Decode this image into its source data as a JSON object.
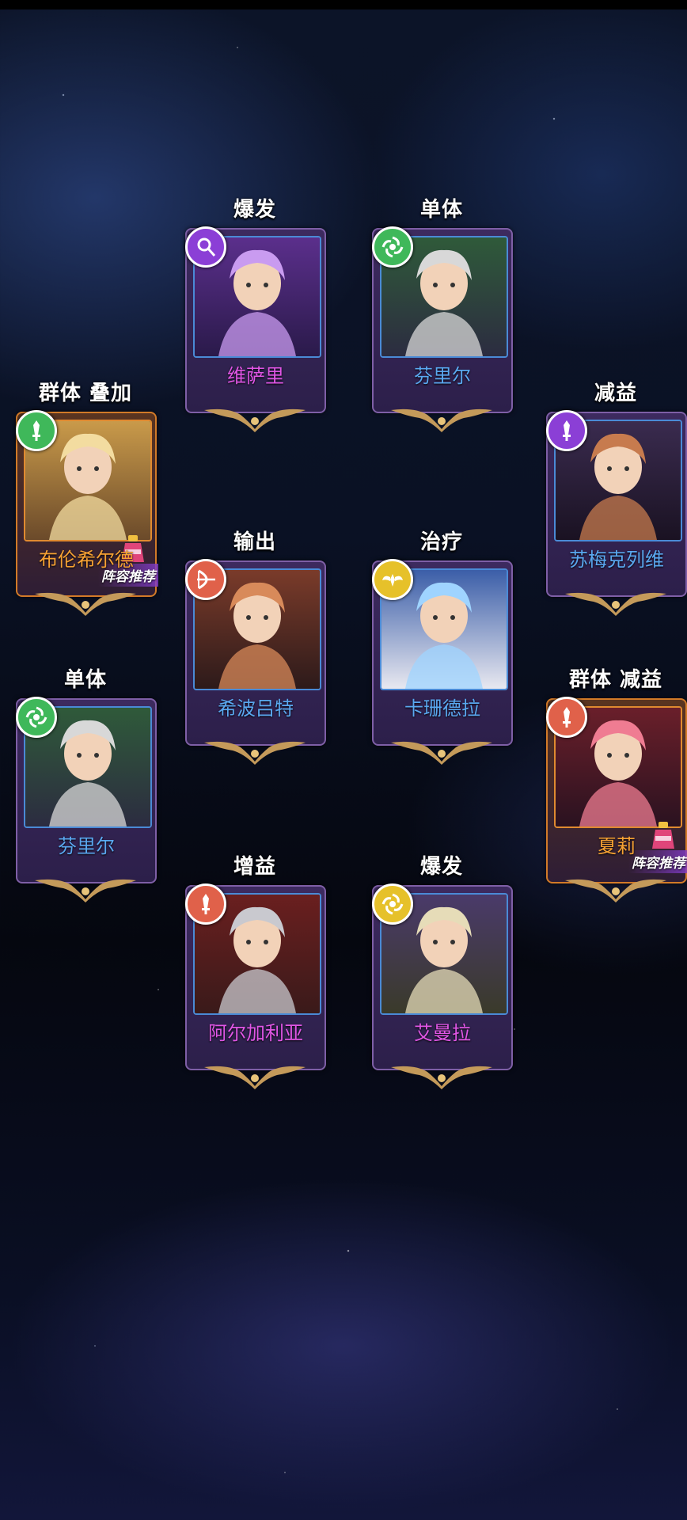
{
  "screen": "team-formation",
  "colors": {
    "name_purple_tier": "#e056e6",
    "name_blue_tier": "#5aa8f0",
    "name_orange_tier": "#f7a233",
    "element_purple": "#8b3fd6",
    "element_green": "#3fb85a",
    "element_red": "#e0614a",
    "element_yellow": "#e6c12a"
  },
  "cards": [
    {
      "tags": "爆发",
      "name": "维萨里",
      "name_color": "#e056e6",
      "element": "purple",
      "element_icon": "magnifier-icon",
      "rarity": "purple"
    },
    {
      "tags": "单体",
      "name": "芬里尔",
      "name_color": "#5aa8f0",
      "element": "green",
      "element_icon": "wind-icon",
      "rarity": "purple"
    },
    {
      "tags": "群体  叠加",
      "name": "布伦希尔德",
      "name_color": "#f7a233",
      "element": "green",
      "element_icon": "sword-icon",
      "rarity": "orange",
      "badge": "阵容推荐"
    },
    {
      "tags": "减益",
      "name": "苏梅克列维",
      "name_color": "#5aa8f0",
      "element": "purple",
      "element_icon": "sword-icon",
      "rarity": "purple"
    },
    {
      "tags": "输出",
      "name": "希波吕特",
      "name_color": "#5aa8f0",
      "element": "red",
      "element_icon": "bow-icon",
      "rarity": "purple"
    },
    {
      "tags": "治疗",
      "name": "卡珊德拉",
      "name_color": "#5aa8f0",
      "element": "yellow",
      "element_icon": "wings-icon",
      "rarity": "purple"
    },
    {
      "tags": "单体",
      "name": "芬里尔",
      "name_color": "#5aa8f0",
      "element": "green",
      "element_icon": "wind-icon",
      "rarity": "purple"
    },
    {
      "tags": "群体  减益",
      "name": "夏莉",
      "name_color": "#f7a233",
      "element": "red",
      "element_icon": "sword-icon",
      "rarity": "orange",
      "badge": "阵容推荐"
    },
    {
      "tags": "增益",
      "name": "阿尔加利亚",
      "name_color": "#e056e6",
      "element": "red",
      "element_icon": "sword-icon",
      "rarity": "purple"
    },
    {
      "tags": "爆发",
      "name": "艾曼拉",
      "name_color": "#e056e6",
      "element": "yellow",
      "element_icon": "wind-icon",
      "rarity": "purple"
    }
  ]
}
